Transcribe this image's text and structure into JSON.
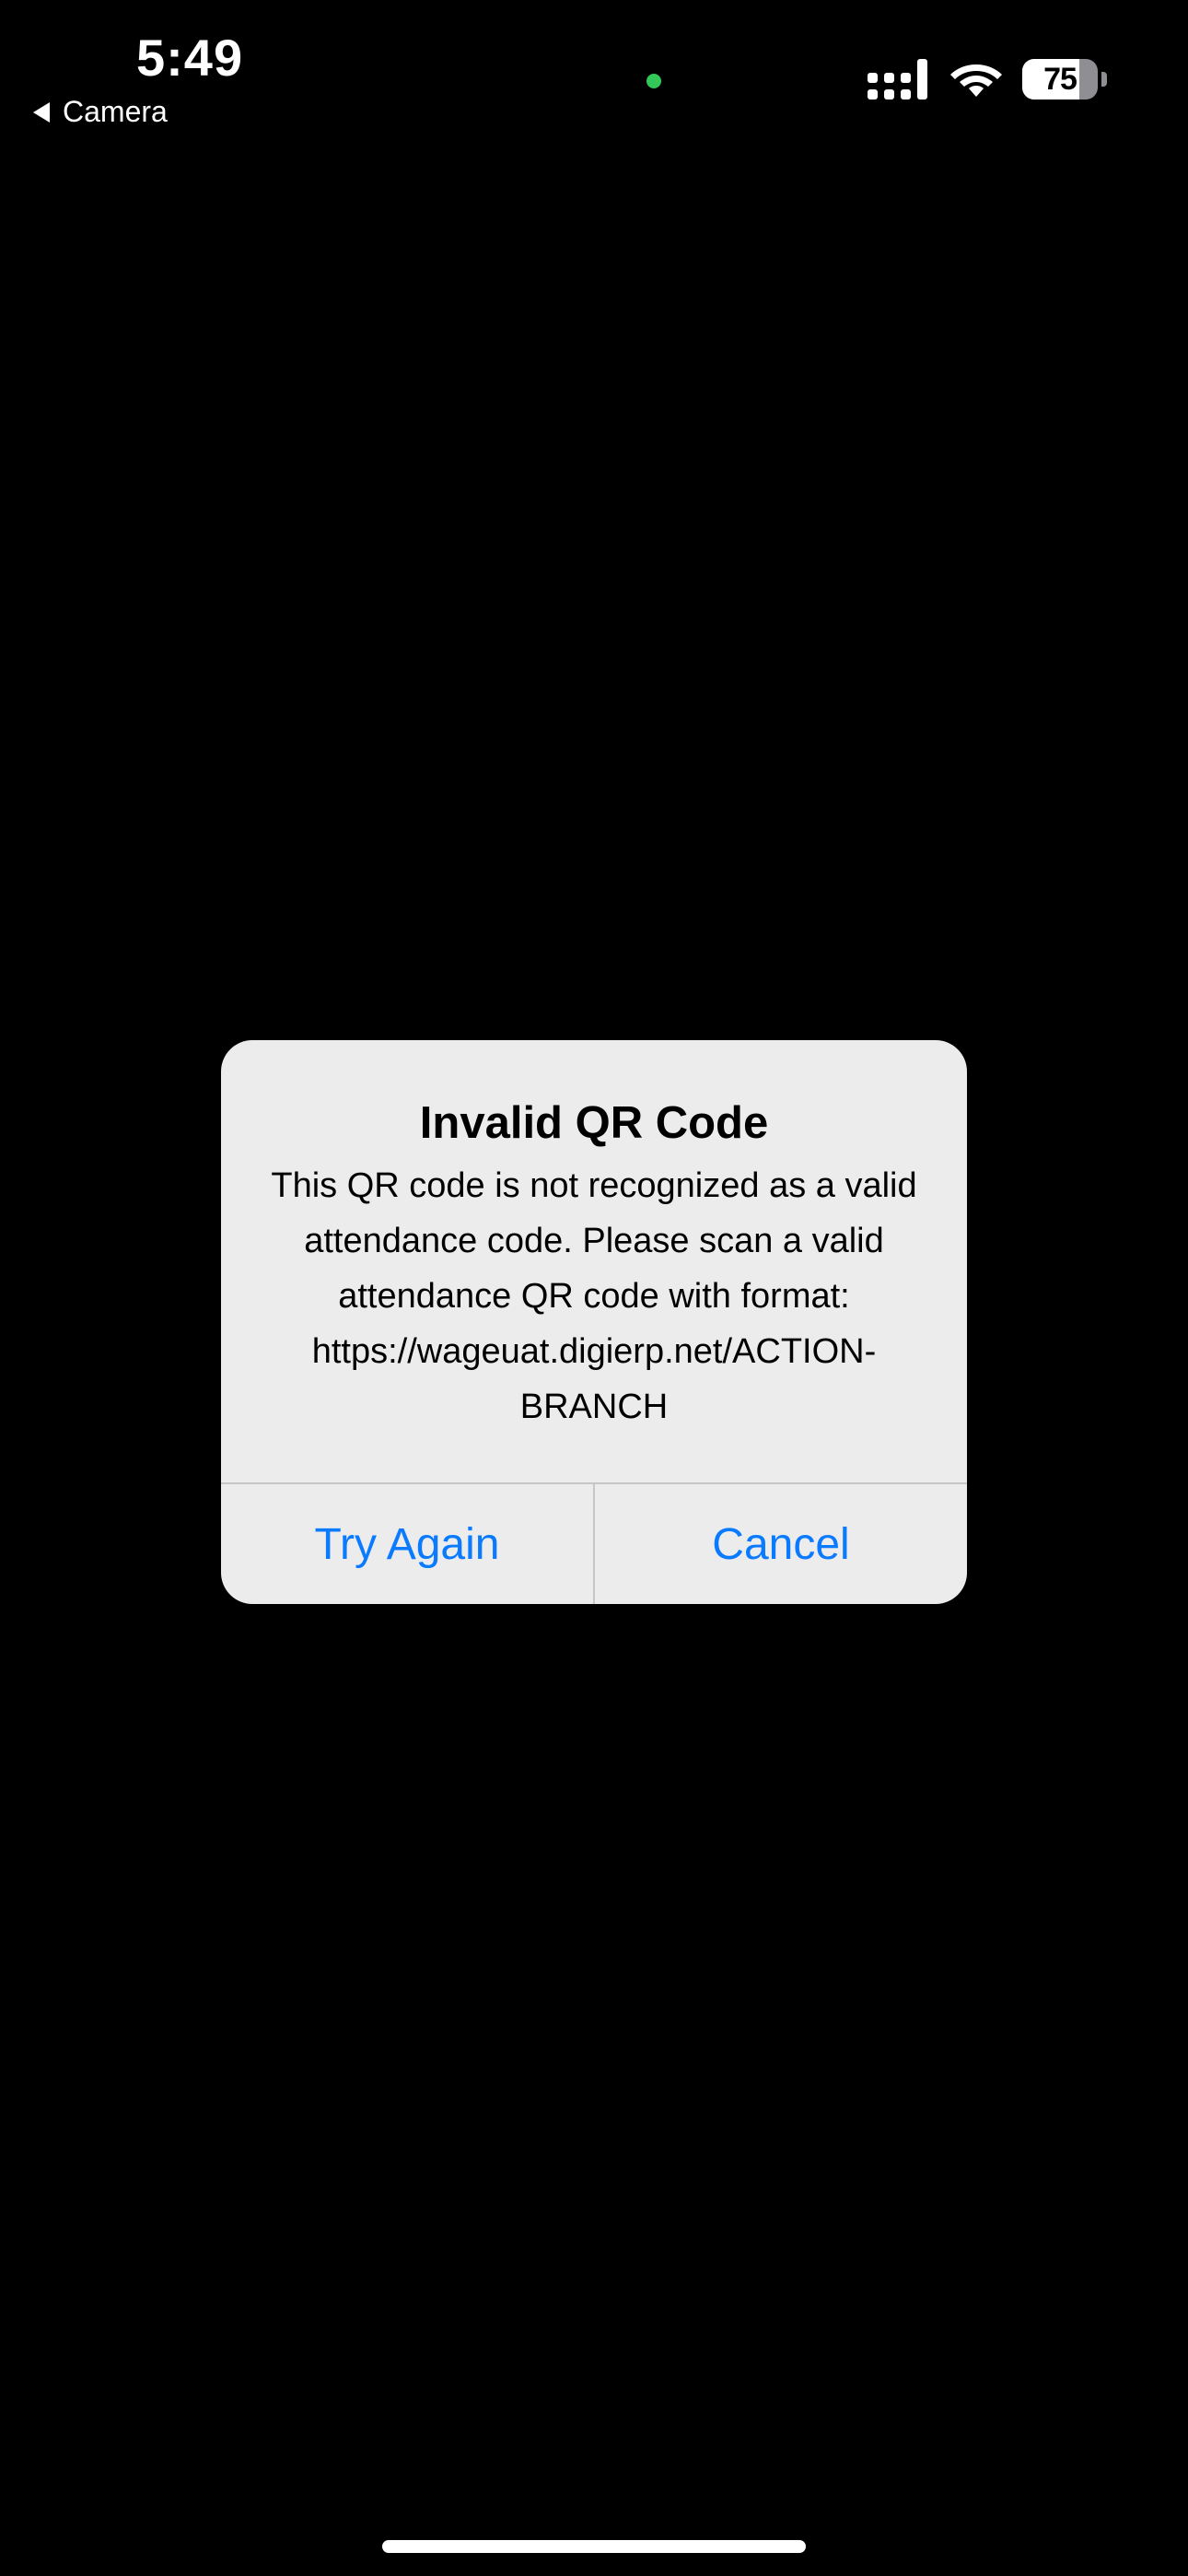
{
  "status_bar": {
    "time": "5:49",
    "back_label": "Camera",
    "battery_percent": "75",
    "battery_level": 0.75,
    "privacy_indicator_color": "#34c759",
    "signal_icon": "cellular-signal-icon",
    "wifi_icon": "wifi-icon"
  },
  "alert": {
    "title": "Invalid QR Code",
    "message": "This QR code is not recognized as a valid attendance code. Please scan a valid attendance QR code with format: https://wageuat.digierp.net/ACTION-BRANCH",
    "buttons": {
      "try_again": "Try Again",
      "cancel": "Cancel"
    },
    "button_color": "#0a7aff"
  }
}
